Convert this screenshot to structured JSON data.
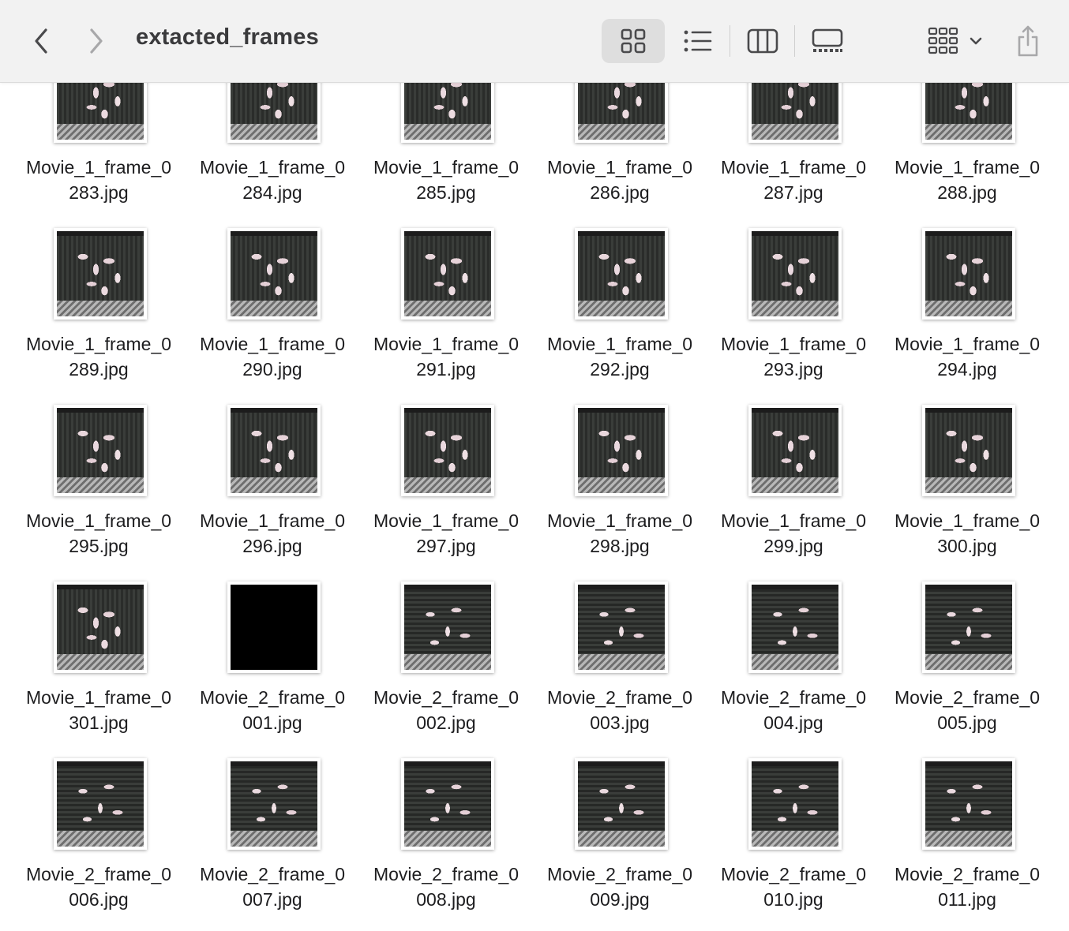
{
  "window": {
    "title": "extacted_frames",
    "icons": {
      "back": "chevron-left-icon",
      "forward": "chevron-right-icon",
      "icon_view": "grid-view-icon",
      "list_view": "list-view-icon",
      "column_view": "column-view-icon",
      "gallery_view": "gallery-view-icon",
      "group": "group-by-icon",
      "share": "share-icon"
    },
    "selected_view": "icon"
  },
  "files": [
    {
      "line1": "Movie_1_frame_0",
      "line2": "283.jpg",
      "thumb": "movie1"
    },
    {
      "line1": "Movie_1_frame_0",
      "line2": "284.jpg",
      "thumb": "movie1"
    },
    {
      "line1": "Movie_1_frame_0",
      "line2": "285.jpg",
      "thumb": "movie1"
    },
    {
      "line1": "Movie_1_frame_0",
      "line2": "286.jpg",
      "thumb": "movie1"
    },
    {
      "line1": "Movie_1_frame_0",
      "line2": "287.jpg",
      "thumb": "movie1"
    },
    {
      "line1": "Movie_1_frame_0",
      "line2": "288.jpg",
      "thumb": "movie1"
    },
    {
      "line1": "Movie_1_frame_0",
      "line2": "289.jpg",
      "thumb": "movie1"
    },
    {
      "line1": "Movie_1_frame_0",
      "line2": "290.jpg",
      "thumb": "movie1"
    },
    {
      "line1": "Movie_1_frame_0",
      "line2": "291.jpg",
      "thumb": "movie1"
    },
    {
      "line1": "Movie_1_frame_0",
      "line2": "292.jpg",
      "thumb": "movie1"
    },
    {
      "line1": "Movie_1_frame_0",
      "line2": "293.jpg",
      "thumb": "movie1"
    },
    {
      "line1": "Movie_1_frame_0",
      "line2": "294.jpg",
      "thumb": "movie1"
    },
    {
      "line1": "Movie_1_frame_0",
      "line2": "295.jpg",
      "thumb": "movie1"
    },
    {
      "line1": "Movie_1_frame_0",
      "line2": "296.jpg",
      "thumb": "movie1"
    },
    {
      "line1": "Movie_1_frame_0",
      "line2": "297.jpg",
      "thumb": "movie1"
    },
    {
      "line1": "Movie_1_frame_0",
      "line2": "298.jpg",
      "thumb": "movie1"
    },
    {
      "line1": "Movie_1_frame_0",
      "line2": "299.jpg",
      "thumb": "movie1"
    },
    {
      "line1": "Movie_1_frame_0",
      "line2": "300.jpg",
      "thumb": "movie1"
    },
    {
      "line1": "Movie_1_frame_0",
      "line2": "301.jpg",
      "thumb": "movie1"
    },
    {
      "line1": "Movie_2_frame_0",
      "line2": "001.jpg",
      "thumb": "black"
    },
    {
      "line1": "Movie_2_frame_0",
      "line2": "002.jpg",
      "thumb": "movie2"
    },
    {
      "line1": "Movie_2_frame_0",
      "line2": "003.jpg",
      "thumb": "movie2"
    },
    {
      "line1": "Movie_2_frame_0",
      "line2": "004.jpg",
      "thumb": "movie2"
    },
    {
      "line1": "Movie_2_frame_0",
      "line2": "005.jpg",
      "thumb": "movie2"
    },
    {
      "line1": "Movie_2_frame_0",
      "line2": "006.jpg",
      "thumb": "movie2"
    },
    {
      "line1": "Movie_2_frame_0",
      "line2": "007.jpg",
      "thumb": "movie2"
    },
    {
      "line1": "Movie_2_frame_0",
      "line2": "008.jpg",
      "thumb": "movie2"
    },
    {
      "line1": "Movie_2_frame_0",
      "line2": "009.jpg",
      "thumb": "movie2"
    },
    {
      "line1": "Movie_2_frame_0",
      "line2": "010.jpg",
      "thumb": "movie2"
    },
    {
      "line1": "Movie_2_frame_0",
      "line2": "011.jpg",
      "thumb": "movie2"
    }
  ]
}
